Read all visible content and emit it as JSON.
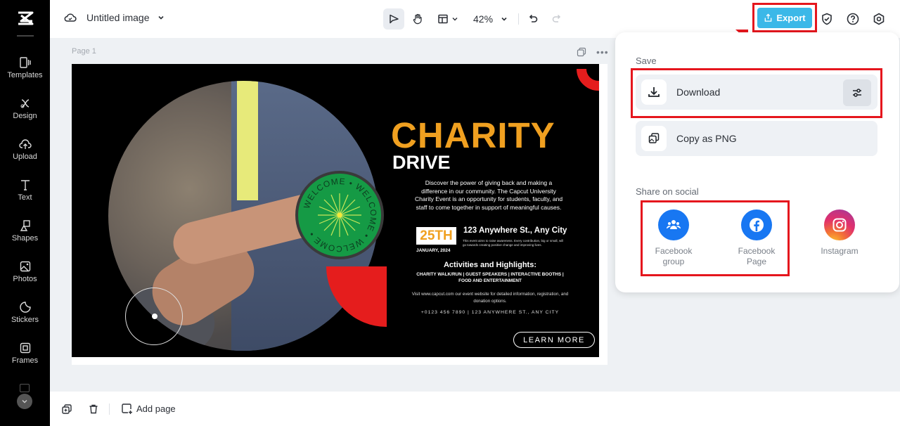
{
  "app": {
    "document_title": "Untitled image"
  },
  "sidebar": {
    "items": [
      {
        "label": "Templates",
        "icon": "templates-icon"
      },
      {
        "label": "Design",
        "icon": "design-icon"
      },
      {
        "label": "Upload",
        "icon": "upload-icon"
      },
      {
        "label": "Text",
        "icon": "text-icon"
      },
      {
        "label": "Shapes",
        "icon": "shapes-icon"
      },
      {
        "label": "Photos",
        "icon": "photos-icon"
      },
      {
        "label": "Stickers",
        "icon": "stickers-icon"
      },
      {
        "label": "Frames",
        "icon": "frames-icon"
      }
    ]
  },
  "toolbar": {
    "zoom": "42%",
    "export_label": "Export"
  },
  "canvas": {
    "page_label": "Page 1",
    "poster": {
      "title1": "CHARITY",
      "title2": "DRIVE",
      "description": "Discover the power of giving back and making a difference in our community. The Capcut University Charity Event is an opportunity for students, faculty, and staff to come together in support of meaningful causes.",
      "date_day": "25TH",
      "date_month": "JANUARY, 2024",
      "address": "123 Anywhere St., Any City",
      "address_note": "This event aims to raise awareness. Every contribution, big or small, will go towards creating positive change and improving lives.",
      "activities_heading": "Activities and Highlights:",
      "activities_list": "CHARITY WALK/RUN | GUEST SPEAKERS | INTERACTIVE BOOTHS | FOOD AND ENTERTAINMENT",
      "visit_text": "Visit www.capcut.com our event website for detailed information, registration, and donation options.",
      "contact": "+0123 456 7890 | 123 ANYWHERE ST., ANY CITY",
      "cta": "LEARN MORE",
      "badge_text": "WELCOME"
    }
  },
  "bottombar": {
    "add_page": "Add page"
  },
  "export_panel": {
    "save_heading": "Save",
    "download_label": "Download",
    "copy_label": "Copy as PNG",
    "share_heading": "Share on social",
    "social": [
      {
        "label": "Facebook group",
        "line1": "Facebook",
        "line2": "group",
        "color": "#1877f2"
      },
      {
        "label": "Facebook Page",
        "line1": "Facebook",
        "line2": "Page",
        "color": "#1877f2"
      },
      {
        "label": "Instagram",
        "line1": "Instagram",
        "line2": ""
      }
    ]
  },
  "colors": {
    "accent_export": "#3bb8e8",
    "highlight": "#e5161d",
    "poster_orange": "#f0a020"
  }
}
